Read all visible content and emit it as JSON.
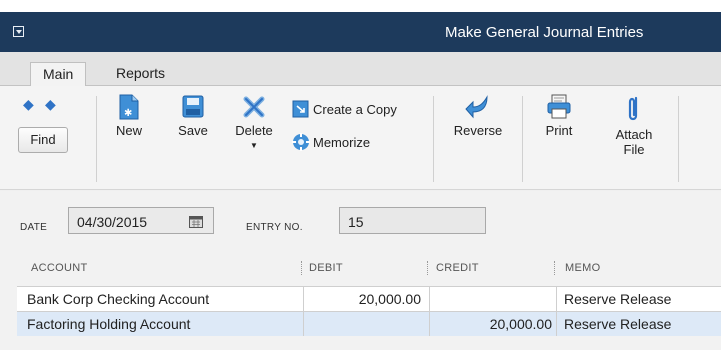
{
  "window": {
    "title": "Make General Journal Entries"
  },
  "tabs": [
    {
      "label": "Main",
      "active": true
    },
    {
      "label": "Reports",
      "active": false
    }
  ],
  "toolbar": {
    "find_label": "Find",
    "new_label": "New",
    "save_label": "Save",
    "delete_label": "Delete",
    "create_copy_label": "Create a Copy",
    "memorize_label": "Memorize",
    "reverse_label": "Reverse",
    "print_label": "Print",
    "attach_label_1": "Attach",
    "attach_label_2": "File"
  },
  "form": {
    "date_label": "DATE",
    "date_value": "04/30/2015",
    "entry_no_label": "ENTRY NO.",
    "entry_no_value": "15"
  },
  "grid": {
    "headers": {
      "account": "ACCOUNT",
      "debit": "DEBIT",
      "credit": "CREDIT",
      "memo": "MEMO"
    },
    "rows": [
      {
        "account": "Bank Corp Checking Account",
        "debit": "20,000.00",
        "credit": "",
        "memo": "Reserve Release"
      },
      {
        "account": "Factoring Holding Account",
        "debit": "",
        "credit": "20,000.00",
        "memo": "Reserve Release"
      }
    ]
  },
  "colors": {
    "titlebar": "#1d3a5c",
    "accent": "#2f73c6",
    "selected_row": "#dde9f7"
  },
  "icons": [
    "window-menu-icon",
    "prev-arrow-icon",
    "next-arrow-icon",
    "new-icon",
    "save-icon",
    "delete-icon",
    "create-copy-icon",
    "memorize-icon",
    "reverse-icon",
    "print-icon",
    "attach-icon",
    "calendar-icon"
  ]
}
